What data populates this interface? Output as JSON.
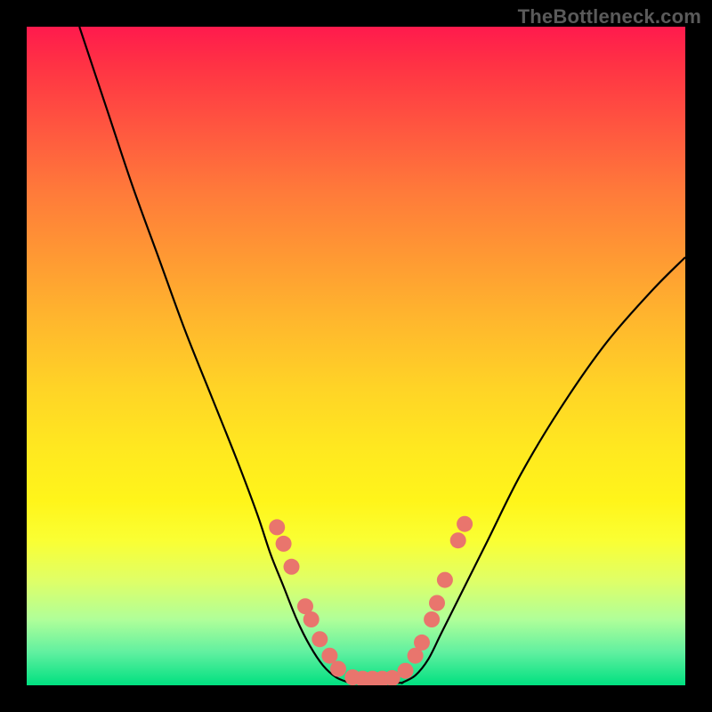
{
  "watermark": "TheBottleneck.com",
  "chart_data": {
    "type": "line",
    "title": "",
    "xlabel": "",
    "ylabel": "",
    "xlim": [
      0,
      100
    ],
    "ylim": [
      0,
      100
    ],
    "series": [
      {
        "name": "left-curve",
        "x": [
          8,
          12,
          16,
          20,
          24,
          28,
          32,
          35,
          37,
          39,
          41,
          43,
          45,
          47,
          49
        ],
        "y": [
          100,
          88,
          76,
          65,
          54,
          44,
          34,
          26,
          20,
          15,
          10,
          6,
          3,
          1.2,
          0.4
        ]
      },
      {
        "name": "valley-floor",
        "x": [
          49,
          51,
          53,
          55,
          57
        ],
        "y": [
          0.4,
          0.3,
          0.3,
          0.3,
          0.4
        ]
      },
      {
        "name": "right-curve",
        "x": [
          57,
          59,
          61,
          63,
          66,
          70,
          75,
          81,
          88,
          95,
          100
        ],
        "y": [
          0.4,
          1.5,
          4,
          8,
          14,
          22,
          32,
          42,
          52,
          60,
          65
        ]
      }
    ],
    "markers": {
      "name": "highlighted-points",
      "color": "#e9756d",
      "radius": 9,
      "points": [
        {
          "x": 38.0,
          "y": 24.0
        },
        {
          "x": 39.0,
          "y": 21.5
        },
        {
          "x": 40.2,
          "y": 18.0
        },
        {
          "x": 42.3,
          "y": 12.0
        },
        {
          "x": 43.2,
          "y": 10.0
        },
        {
          "x": 44.5,
          "y": 7.0
        },
        {
          "x": 46.0,
          "y": 4.5
        },
        {
          "x": 47.3,
          "y": 2.5
        },
        {
          "x": 49.5,
          "y": 1.2
        },
        {
          "x": 51.0,
          "y": 1.0
        },
        {
          "x": 52.5,
          "y": 1.0
        },
        {
          "x": 54.0,
          "y": 1.0
        },
        {
          "x": 55.5,
          "y": 1.1
        },
        {
          "x": 57.5,
          "y": 2.2
        },
        {
          "x": 59.0,
          "y": 4.5
        },
        {
          "x": 60.0,
          "y": 6.5
        },
        {
          "x": 61.5,
          "y": 10.0
        },
        {
          "x": 62.3,
          "y": 12.5
        },
        {
          "x": 63.5,
          "y": 16.0
        },
        {
          "x": 65.5,
          "y": 22.0
        },
        {
          "x": 66.5,
          "y": 24.5
        }
      ]
    }
  }
}
